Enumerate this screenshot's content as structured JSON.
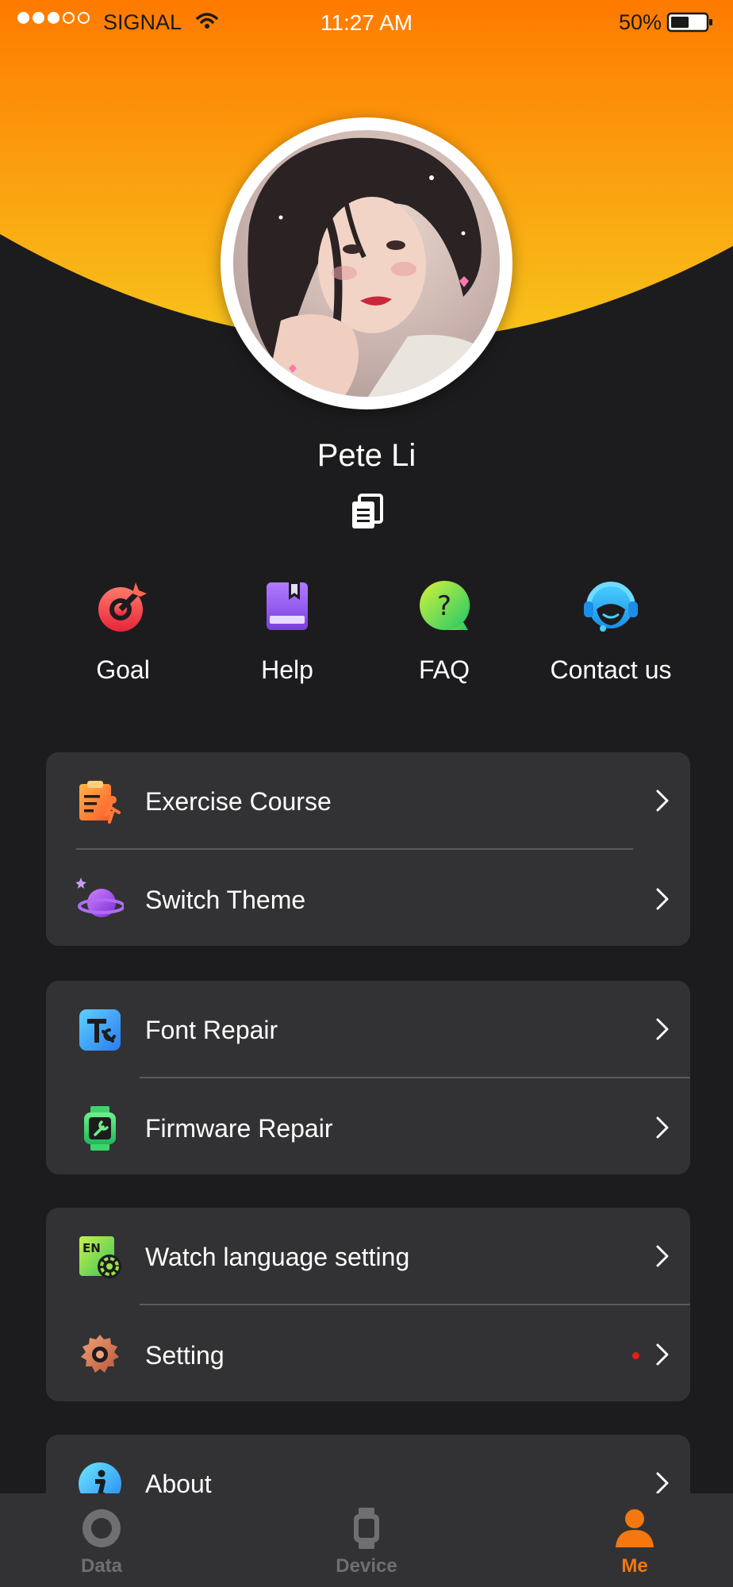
{
  "status_bar": {
    "carrier": "SIGNAL",
    "time": "11:27 AM",
    "battery": "50%"
  },
  "profile": {
    "name": "Pete Li"
  },
  "quick_actions": [
    {
      "label": "Goal",
      "icon": "goal-icon"
    },
    {
      "label": "Help",
      "icon": "help-book-icon"
    },
    {
      "label": "FAQ",
      "icon": "faq-icon"
    },
    {
      "label": "Contact us",
      "icon": "headset-icon"
    }
  ],
  "menu": {
    "group1": [
      {
        "label": "Exercise Course",
        "icon": "exercise-course-icon"
      },
      {
        "label": "Switch Theme",
        "icon": "planet-icon"
      }
    ],
    "group2": [
      {
        "label": "Font Repair",
        "icon": "font-repair-icon"
      },
      {
        "label": "Firmware Repair",
        "icon": "firmware-repair-icon"
      }
    ],
    "group3": [
      {
        "label": "Watch language setting",
        "icon": "language-icon"
      },
      {
        "label": "Setting",
        "icon": "gear-icon"
      }
    ],
    "group4": [
      {
        "label": "About",
        "icon": "info-icon"
      }
    ]
  },
  "tab_bar": {
    "tabs": [
      {
        "label": "Data",
        "icon": "data-icon"
      },
      {
        "label": "Device",
        "icon": "watch-icon"
      },
      {
        "label": "Me",
        "icon": "person-icon"
      }
    ],
    "active": "Me"
  },
  "colors": {
    "accent": "#f4780d",
    "header_top": "#ff7a00",
    "header_bottom": "#f7c41c",
    "background": "#1c1c1e",
    "card": "#323234",
    "notification": "#e0201b"
  }
}
